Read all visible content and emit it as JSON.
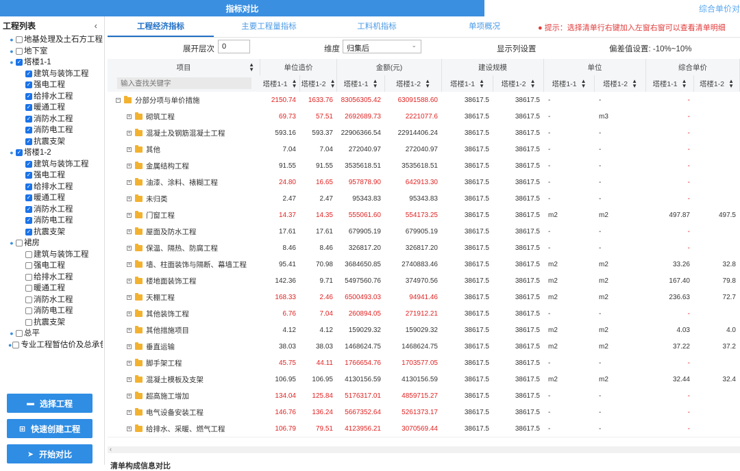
{
  "top_tabs": {
    "active": "指标对比",
    "right": "综合单价对比"
  },
  "sidebar": {
    "title": "工程列表",
    "collapse_icon": "chevron-left-icon",
    "tree": [
      {
        "label": "地基处理及土石方工程",
        "level": 1,
        "checked": false,
        "toggle": "+"
      },
      {
        "label": "地下室",
        "level": 1,
        "checked": false,
        "toggle": "+"
      },
      {
        "label": "塔楼1-1",
        "level": 1,
        "checked": true,
        "toggle": "-"
      },
      {
        "label": "建筑与装饰工程",
        "level": 2,
        "checked": true
      },
      {
        "label": "强电工程",
        "level": 2,
        "checked": true
      },
      {
        "label": "给排水工程",
        "level": 2,
        "checked": true
      },
      {
        "label": "暖通工程",
        "level": 2,
        "checked": true
      },
      {
        "label": "消防水工程",
        "level": 2,
        "checked": true
      },
      {
        "label": "消防电工程",
        "level": 2,
        "checked": true
      },
      {
        "label": "抗震支架",
        "level": 2,
        "checked": true
      },
      {
        "label": "塔楼1-2",
        "level": 1,
        "checked": true,
        "toggle": "-"
      },
      {
        "label": "建筑与装饰工程",
        "level": 2,
        "checked": true
      },
      {
        "label": "强电工程",
        "level": 2,
        "checked": true
      },
      {
        "label": "给排水工程",
        "level": 2,
        "checked": true
      },
      {
        "label": "暖通工程",
        "level": 2,
        "checked": true
      },
      {
        "label": "消防水工程",
        "level": 2,
        "checked": true
      },
      {
        "label": "消防电工程",
        "level": 2,
        "checked": true
      },
      {
        "label": "抗震支架",
        "level": 2,
        "checked": true
      },
      {
        "label": "裙房",
        "level": 1,
        "checked": false,
        "toggle": "-"
      },
      {
        "label": "建筑与装饰工程",
        "level": 2,
        "checked": false
      },
      {
        "label": "强电工程",
        "level": 2,
        "checked": false
      },
      {
        "label": "给排水工程",
        "level": 2,
        "checked": false
      },
      {
        "label": "暖通工程",
        "level": 2,
        "checked": false
      },
      {
        "label": "消防水工程",
        "level": 2,
        "checked": false
      },
      {
        "label": "消防电工程",
        "level": 2,
        "checked": false
      },
      {
        "label": "抗震支架",
        "level": 2,
        "checked": false
      },
      {
        "label": "总平",
        "level": 1,
        "checked": false,
        "toggle": "+"
      },
      {
        "label": "专业工程暂估价及总承包",
        "level": 1,
        "checked": false,
        "toggle": "+"
      }
    ],
    "buttons": [
      {
        "label": "选择工程",
        "icon": "folder-icon",
        "glyph": "▬"
      },
      {
        "label": "快速创建工程",
        "icon": "plus-square-icon",
        "glyph": "⊞"
      },
      {
        "label": "开始对比",
        "icon": "cursor-icon",
        "glyph": "➤"
      }
    ]
  },
  "tabs": [
    "工程经济指标",
    "主要工程量指标",
    "工料机指标",
    "单项概况"
  ],
  "hint": "● 提示：选择清单行右键加入左窗右窗可以查看清单明细",
  "filters": {
    "expand_label": "展开层次",
    "expand_value": "0",
    "dimension_label": "维度",
    "dimension_value": "归集后",
    "column_settings": "显示列设置",
    "deviation_label": "偏差值设置: -10%~10%"
  },
  "table": {
    "group_headers": [
      "项目",
      "单位造价",
      "金额(元)",
      "建设规模",
      "单位",
      "综合单价"
    ],
    "search_placeholder": "输入查找关键字",
    "sub_headers": [
      "塔楼1-1",
      "塔楼1-2",
      "塔楼1-1",
      "塔楼1-2",
      "塔楼1-1",
      "塔楼1-2",
      "塔楼1-1",
      "塔楼1-2",
      "塔楼1-1",
      "塔楼1-2"
    ],
    "rows": [
      {
        "name": "分部分项与单价措施",
        "top": true,
        "uc1": "2150.74",
        "uc2": "1633.76",
        "a1": "83056305.42",
        "a2": "63091588.60",
        "s1": "38617.5",
        "s2": "38617.5",
        "u1": "-",
        "u2": "-",
        "p1": "-",
        "p2": "",
        "red": true
      },
      {
        "name": "砌筑工程",
        "uc1": "69.73",
        "uc2": "57.51",
        "a1": "2692689.73",
        "a2": "2221077.6",
        "s1": "38617.5",
        "s2": "38617.5",
        "u1": "-",
        "u2": "m3",
        "p1": "-",
        "p2": "",
        "red": true
      },
      {
        "name": "混凝土及钢筋混凝土工程",
        "uc1": "593.16",
        "uc2": "593.37",
        "a1": "22906366.54",
        "a2": "22914406.24",
        "s1": "38617.5",
        "s2": "38617.5",
        "u1": "-",
        "u2": "-",
        "p1": "-",
        "p2": "",
        "red": false
      },
      {
        "name": "其他",
        "uc1": "7.04",
        "uc2": "7.04",
        "a1": "272040.97",
        "a2": "272040.97",
        "s1": "38617.5",
        "s2": "38617.5",
        "u1": "-",
        "u2": "-",
        "p1": "-",
        "p2": "",
        "red": false
      },
      {
        "name": "金属结构工程",
        "uc1": "91.55",
        "uc2": "91.55",
        "a1": "3535618.51",
        "a2": "3535618.51",
        "s1": "38617.5",
        "s2": "38617.5",
        "u1": "-",
        "u2": "-",
        "p1": "-",
        "p2": "",
        "red": false
      },
      {
        "name": "油漆、涂料、裱糊工程",
        "uc1": "24.80",
        "uc2": "16.65",
        "a1": "957878.90",
        "a2": "642913.30",
        "s1": "38617.5",
        "s2": "38617.5",
        "u1": "-",
        "u2": "-",
        "p1": "-",
        "p2": "",
        "red": true
      },
      {
        "name": "未归类",
        "uc1": "2.47",
        "uc2": "2.47",
        "a1": "95343.83",
        "a2": "95343.83",
        "s1": "38617.5",
        "s2": "38617.5",
        "u1": "-",
        "u2": "-",
        "p1": "-",
        "p2": "",
        "red": false
      },
      {
        "name": "门窗工程",
        "uc1": "14.37",
        "uc2": "14.35",
        "a1": "555061.60",
        "a2": "554173.25",
        "s1": "38617.5",
        "s2": "38617.5",
        "u1": "m2",
        "u2": "m2",
        "p1": "497.87",
        "p2": "497.5",
        "red": true
      },
      {
        "name": "屋面及防水工程",
        "uc1": "17.61",
        "uc2": "17.61",
        "a1": "679905.19",
        "a2": "679905.19",
        "s1": "38617.5",
        "s2": "38617.5",
        "u1": "-",
        "u2": "-",
        "p1": "-",
        "p2": "",
        "red": false
      },
      {
        "name": "保温、隔热、防腐工程",
        "uc1": "8.46",
        "uc2": "8.46",
        "a1": "326817.20",
        "a2": "326817.20",
        "s1": "38617.5",
        "s2": "38617.5",
        "u1": "-",
        "u2": "-",
        "p1": "-",
        "p2": "",
        "red": false
      },
      {
        "name": "墙、柱面装饰与隔断、幕墙工程",
        "uc1": "95.41",
        "uc2": "70.98",
        "a1": "3684650.85",
        "a2": "2740883.46",
        "s1": "38617.5",
        "s2": "38617.5",
        "u1": "m2",
        "u2": "m2",
        "p1": "33.26",
        "p2": "32.8",
        "red": false
      },
      {
        "name": "楼地面装饰工程",
        "uc1": "142.36",
        "uc2": "9.71",
        "a1": "5497560.76",
        "a2": "374970.56",
        "s1": "38617.5",
        "s2": "38617.5",
        "u1": "m2",
        "u2": "m2",
        "p1": "167.40",
        "p2": "79.8",
        "red": false
      },
      {
        "name": "天棚工程",
        "uc1": "168.33",
        "uc2": "2.46",
        "a1": "6500493.03",
        "a2": "94941.46",
        "s1": "38617.5",
        "s2": "38617.5",
        "u1": "m2",
        "u2": "m2",
        "p1": "236.63",
        "p2": "72.7",
        "red": true
      },
      {
        "name": "其他装饰工程",
        "uc1": "6.76",
        "uc2": "7.04",
        "a1": "260894.05",
        "a2": "271912.21",
        "s1": "38617.5",
        "s2": "38617.5",
        "u1": "-",
        "u2": "-",
        "p1": "-",
        "p2": "",
        "red": true
      },
      {
        "name": "其他措施项目",
        "uc1": "4.12",
        "uc2": "4.12",
        "a1": "159029.32",
        "a2": "159029.32",
        "s1": "38617.5",
        "s2": "38617.5",
        "u1": "m2",
        "u2": "m2",
        "p1": "4.03",
        "p2": "4.0",
        "red": false
      },
      {
        "name": "垂直运输",
        "uc1": "38.03",
        "uc2": "38.03",
        "a1": "1468624.75",
        "a2": "1468624.75",
        "s1": "38617.5",
        "s2": "38617.5",
        "u1": "m2",
        "u2": "m2",
        "p1": "37.22",
        "p2": "37.2",
        "red": false
      },
      {
        "name": "脚手架工程",
        "uc1": "45.75",
        "uc2": "44.11",
        "a1": "1766654.76",
        "a2": "1703577.05",
        "s1": "38617.5",
        "s2": "38617.5",
        "u1": "-",
        "u2": "-",
        "p1": "-",
        "p2": "",
        "red": true
      },
      {
        "name": "混凝土模板及支架",
        "uc1": "106.95",
        "uc2": "106.95",
        "a1": "4130156.59",
        "a2": "4130156.59",
        "s1": "38617.5",
        "s2": "38617.5",
        "u1": "m2",
        "u2": "m2",
        "p1": "32.44",
        "p2": "32.4",
        "red": false
      },
      {
        "name": "超高施工增加",
        "uc1": "134.04",
        "uc2": "125.84",
        "a1": "5176317.01",
        "a2": "4859715.27",
        "s1": "38617.5",
        "s2": "38617.5",
        "u1": "-",
        "u2": "-",
        "p1": "-",
        "p2": "",
        "red": true
      },
      {
        "name": "电气设备安装工程",
        "uc1": "146.76",
        "uc2": "136.24",
        "a1": "5667352.64",
        "a2": "5261373.17",
        "s1": "38617.5",
        "s2": "38617.5",
        "u1": "-",
        "u2": "-",
        "p1": "-",
        "p2": "",
        "red": true
      },
      {
        "name": "给排水、采暖、燃气工程",
        "uc1": "106.79",
        "uc2": "79.51",
        "a1": "4123956.21",
        "a2": "3070569.44",
        "s1": "38617.5",
        "s2": "38617.5",
        "u1": "-",
        "u2": "-",
        "p1": "-",
        "p2": "",
        "red": true
      }
    ]
  },
  "bottom_label": "清单构成信息对比"
}
